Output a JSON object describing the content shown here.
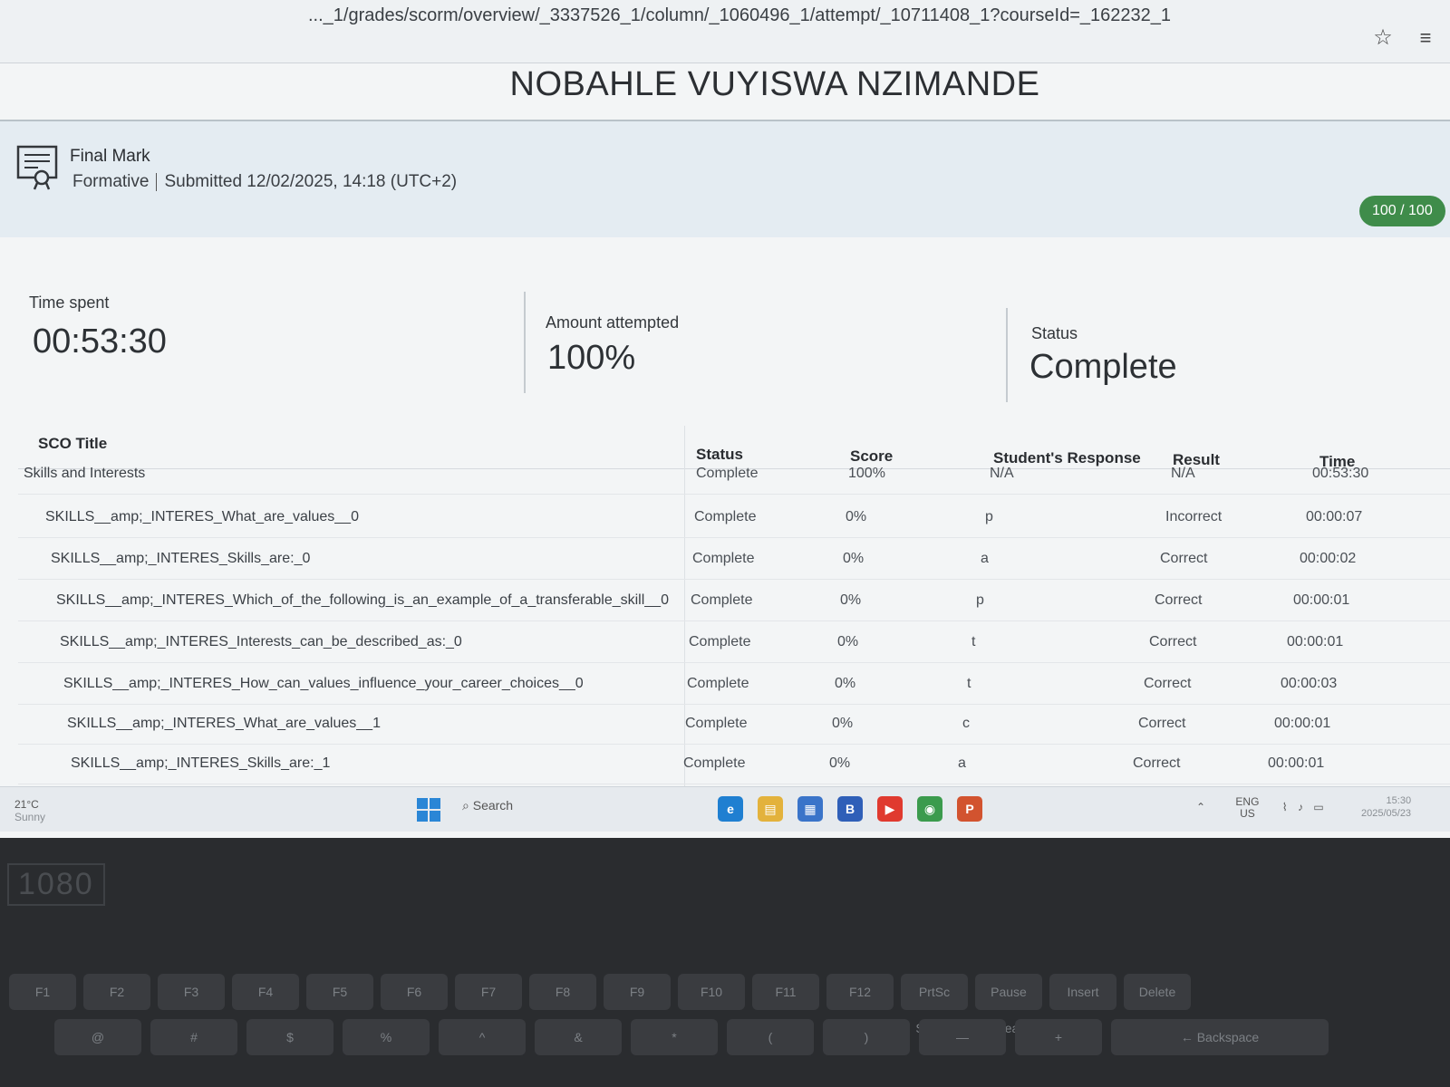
{
  "browser": {
    "url": "..._1/grades/scorm/overview/_3337526_1/column/_1060496_1/attempt/_10711408_1?courseId=_162232_1"
  },
  "student_name": "NOBAHLE VUYISWA NZIMANDE",
  "final_mark": {
    "title": "Final Mark",
    "type": "Formative",
    "submitted": "Submitted 12/02/2025, 14:18 (UTC+2)",
    "score_badge": "100 / 100"
  },
  "stats": {
    "time_spent_label": "Time spent",
    "time_spent_value": "00:53:30",
    "amount_attempted_label": "Amount attempted",
    "amount_attempted_value": "100%",
    "status_label": "Status",
    "status_value": "Complete"
  },
  "table": {
    "headers": {
      "title": "SCO Title",
      "status": "Status",
      "score": "Score",
      "response": "Student's Response",
      "result": "Result",
      "time": "Time"
    },
    "rows": [
      {
        "title": "Skills and Interests",
        "status": "Complete",
        "score": "100%",
        "response": "N/A",
        "result": "N/A",
        "time": "00:53:30"
      },
      {
        "title": "SKILLS__amp;_INTERES_What_are_values__0",
        "status": "Complete",
        "score": "0%",
        "response": "p",
        "result": "Incorrect",
        "time": "00:00:07"
      },
      {
        "title": "SKILLS__amp;_INTERES_Skills_are:_0",
        "status": "Complete",
        "score": "0%",
        "response": "a",
        "result": "Correct",
        "time": "00:00:02"
      },
      {
        "title": "SKILLS__amp;_INTERES_Which_of_the_following_is_an_example_of_a_transferable_skill__0",
        "status": "Complete",
        "score": "0%",
        "response": "p",
        "result": "Correct",
        "time": "00:00:01"
      },
      {
        "title": "SKILLS__amp;_INTERES_Interests_can_be_described_as:_0",
        "status": "Complete",
        "score": "0%",
        "response": "t",
        "result": "Correct",
        "time": "00:00:01"
      },
      {
        "title": "SKILLS__amp;_INTERES_How_can_values_influence_your_career_choices__0",
        "status": "Complete",
        "score": "0%",
        "response": "t",
        "result": "Correct",
        "time": "00:00:03"
      },
      {
        "title": "SKILLS__amp;_INTERES_What_are_values__1",
        "status": "Complete",
        "score": "0%",
        "response": "c",
        "result": "Correct",
        "time": "00:00:01"
      },
      {
        "title": "SKILLS__amp;_INTERES_Skills_are:_1",
        "status": "Complete",
        "score": "0%",
        "response": "a",
        "result": "Correct",
        "time": "00:00:01"
      }
    ]
  },
  "taskbar": {
    "weather_temp": "21°C",
    "weather_desc": "Sunny",
    "search": "Search",
    "lang": "ENG",
    "region": "US",
    "time": "15:30",
    "date": "2025/05/23",
    "apps": [
      {
        "name": "edge",
        "label": "e",
        "color": "#1f7fd1"
      },
      {
        "name": "files",
        "label": "▤",
        "color": "#e3b23c"
      },
      {
        "name": "store",
        "label": "▦",
        "color": "#3a74c9"
      },
      {
        "name": "b-app",
        "label": "B",
        "color": "#2f5fb8"
      },
      {
        "name": "youtube",
        "label": "▶",
        "color": "#e03a2f"
      },
      {
        "name": "chrome",
        "label": "◉",
        "color": "#3b9b4d"
      },
      {
        "name": "powerpoint",
        "label": "P",
        "color": "#d2532f"
      }
    ]
  },
  "keyboard": {
    "bezel_label": "1080",
    "fn_keys": [
      "F1",
      "F2",
      "F3",
      "F4",
      "F5",
      "F6",
      "F7",
      "F8",
      "F9",
      "F10",
      "F11",
      "F12",
      "PrtSc SysRq",
      "Pause Break",
      "Insert",
      "Delete"
    ],
    "num_keys": [
      "@",
      "#",
      "$",
      "%",
      "^",
      "&",
      "*",
      "(",
      ")",
      "—",
      "+",
      "← Backspace"
    ]
  }
}
